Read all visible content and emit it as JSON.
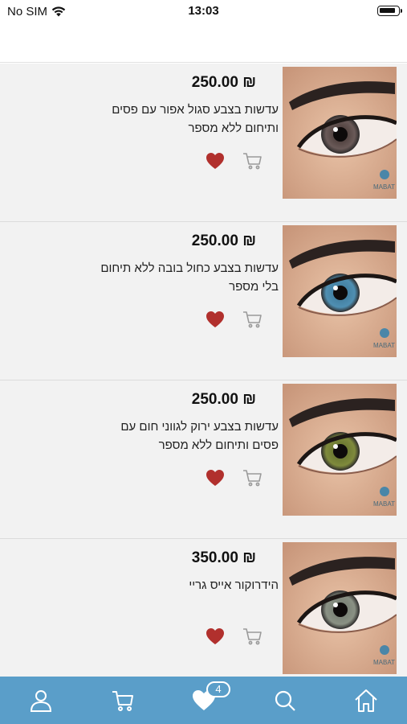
{
  "status_bar": {
    "carrier": "No SIM",
    "time": "13:03",
    "battery_level": 0.9
  },
  "products": [
    {
      "price": "₪ 250.00",
      "description": "עדשות בצבע סגול אפור עם פסים ותיחום ללא מספר",
      "iris_color": "#6a5a58",
      "iris_inner_color": "#3d2f2c",
      "favorite": true,
      "watermark": "MABAT"
    },
    {
      "price": "₪ 250.00",
      "description": "עדשות בצבע כחול בובה ללא תיחום בלי מספר",
      "iris_color": "#4f8fb2",
      "iris_inner_color": "#3a7393",
      "favorite": true,
      "watermark": "MABAT"
    },
    {
      "price": "₪ 250.00",
      "description": "עדשות בצבע ירוק לגווני חום עם פסים ותיחום ללא מספר",
      "iris_color": "#7f8a3c",
      "iris_inner_color": "#5c6a2a",
      "favorite": true,
      "watermark": "MABAT"
    },
    {
      "price": "₪ 350.00",
      "description": "הידרוקור אייס גריי",
      "iris_color": "#8a9184",
      "iris_inner_color": "#6f776d",
      "favorite": true,
      "watermark": "MABAT"
    }
  ],
  "bottom_nav": {
    "items": [
      {
        "icon": "user-icon"
      },
      {
        "icon": "cart-icon"
      },
      {
        "icon": "heart-icon",
        "badge": "4"
      },
      {
        "icon": "search-icon"
      },
      {
        "icon": "home-icon"
      }
    ],
    "background_color": "#5a9ec9"
  },
  "colors": {
    "favorite_heart": "#b1302d",
    "cart_icon": "#9a9a9a",
    "nav_icon": "#ffffff"
  }
}
